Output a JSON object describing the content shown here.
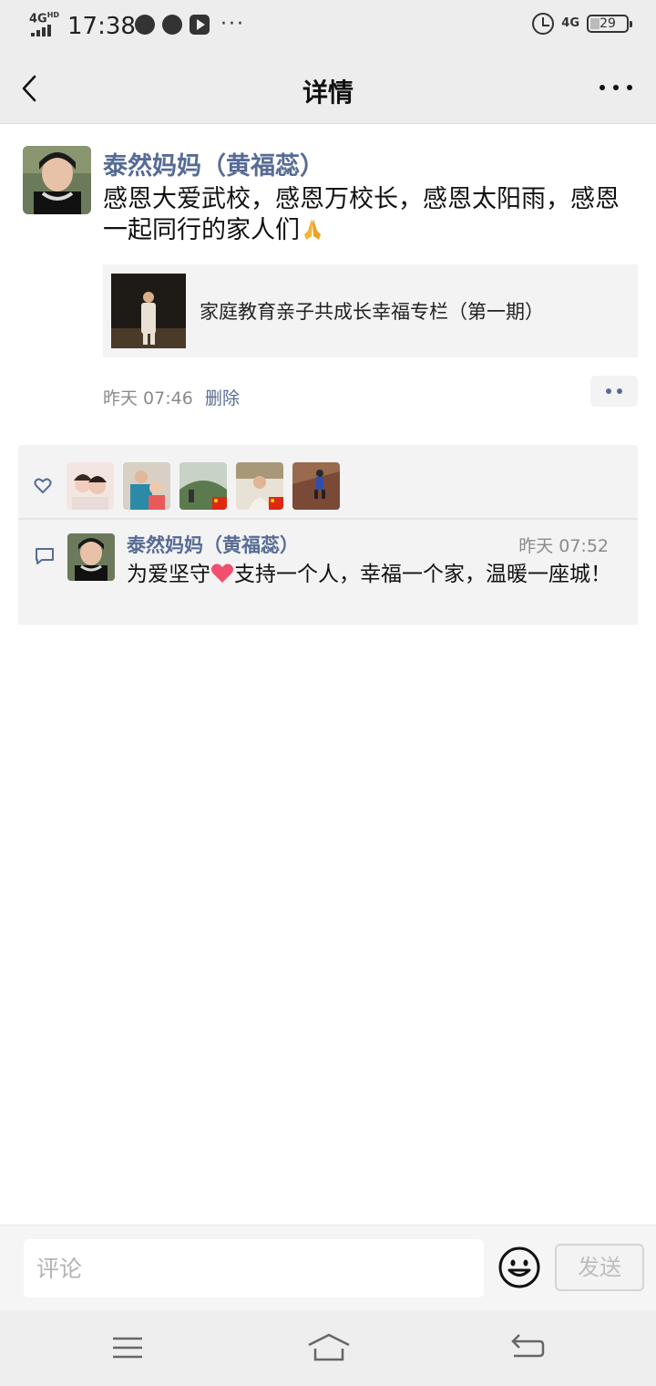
{
  "status_bar": {
    "network": "4G",
    "network_sup": "HD",
    "time": "17:38",
    "dots": "···",
    "right_network": "4G",
    "battery": "29"
  },
  "nav": {
    "title": "详情"
  },
  "post": {
    "author": "泰然妈妈（黄福蕊）",
    "text": "感恩大爱武校，感恩万校长，感恩太阳雨，感恩一起同行的家人们",
    "link_title": "家庭教育亲子共成长幸福专栏（第一期）",
    "time": "昨天 07:46",
    "delete_label": "删除"
  },
  "comments": [
    {
      "author": "泰然妈妈（黄福蕊）",
      "time": "昨天 07:52",
      "text_before": "为爱坚守",
      "text_after": "支持一个人，幸福一个家，温暖一座城！"
    }
  ],
  "input_bar": {
    "placeholder": "评论",
    "send_label": "发送"
  },
  "colors": {
    "link_blue": "#576b95",
    "nav_bg": "#ededed",
    "panel_bg": "#f3f3f3"
  }
}
